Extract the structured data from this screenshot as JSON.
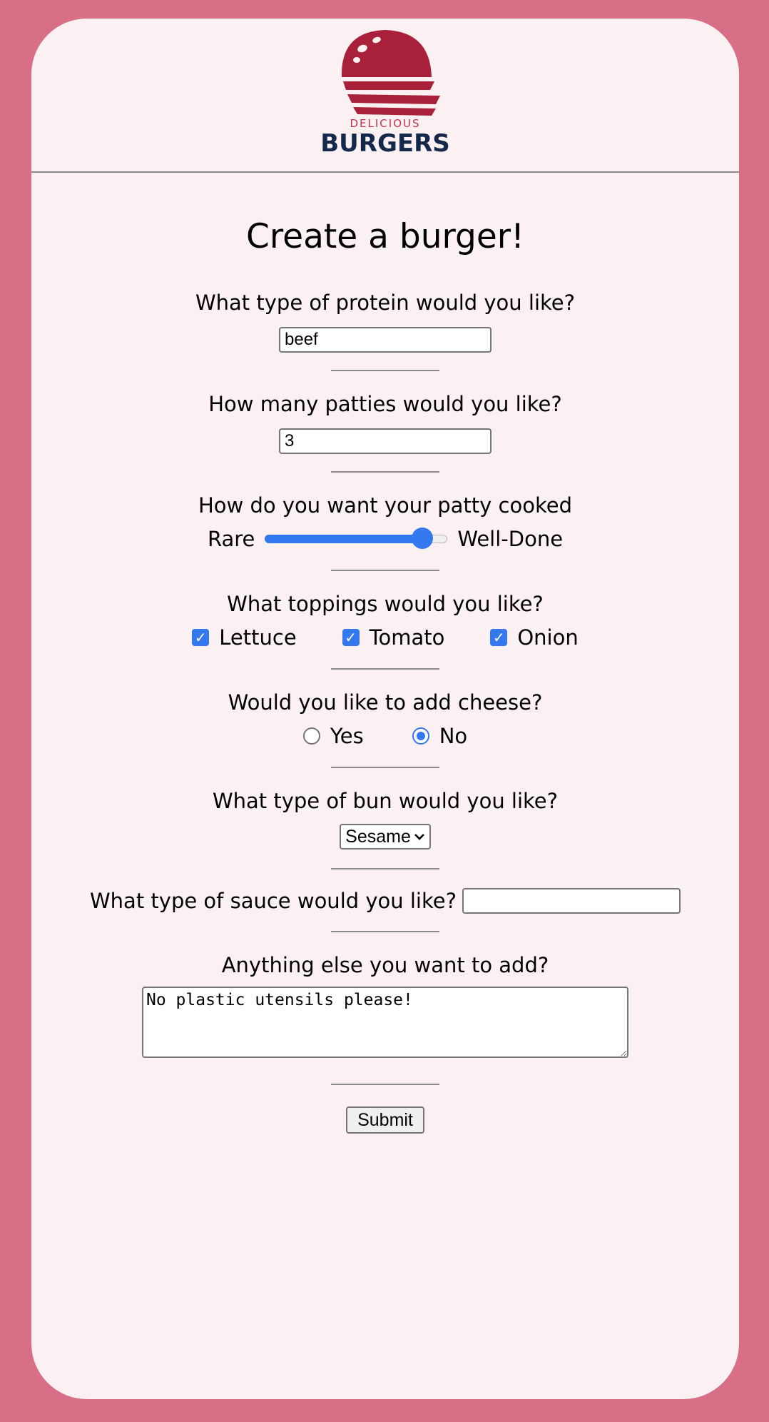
{
  "logo": {
    "small_text": "DELICIOUS",
    "big_text": "BURGERS",
    "bun_color": "#a8203a",
    "text_color": "#13284a"
  },
  "title": "Create a burger!",
  "protein": {
    "question": "What type of protein would you like?",
    "value": "beef"
  },
  "patties": {
    "question": "How many patties would you like?",
    "value": "3"
  },
  "cooked": {
    "question": "How do you want your patty cooked",
    "min_label": "Rare",
    "max_label": "Well-Done",
    "level_fraction": 0.86
  },
  "toppings": {
    "question": "What toppings would you like?",
    "options": [
      {
        "label": "Lettuce",
        "checked": true
      },
      {
        "label": "Tomato",
        "checked": true
      },
      {
        "label": "Onion",
        "checked": true
      }
    ]
  },
  "cheese": {
    "question": "Would you like to add cheese?",
    "options": [
      {
        "label": "Yes",
        "selected": false
      },
      {
        "label": "No",
        "selected": true
      }
    ]
  },
  "bun": {
    "question": "What type of bun would you like?",
    "selected": "Sesame"
  },
  "sauce": {
    "question": "What type of sauce would you like?",
    "value": ""
  },
  "notes": {
    "question": "Anything else you want to add?",
    "value": "No plastic utensils please!"
  },
  "submit_label": "Submit",
  "colors": {
    "background": "#d76f86",
    "card": "#fbf0f2",
    "accent": "#3478ef"
  }
}
